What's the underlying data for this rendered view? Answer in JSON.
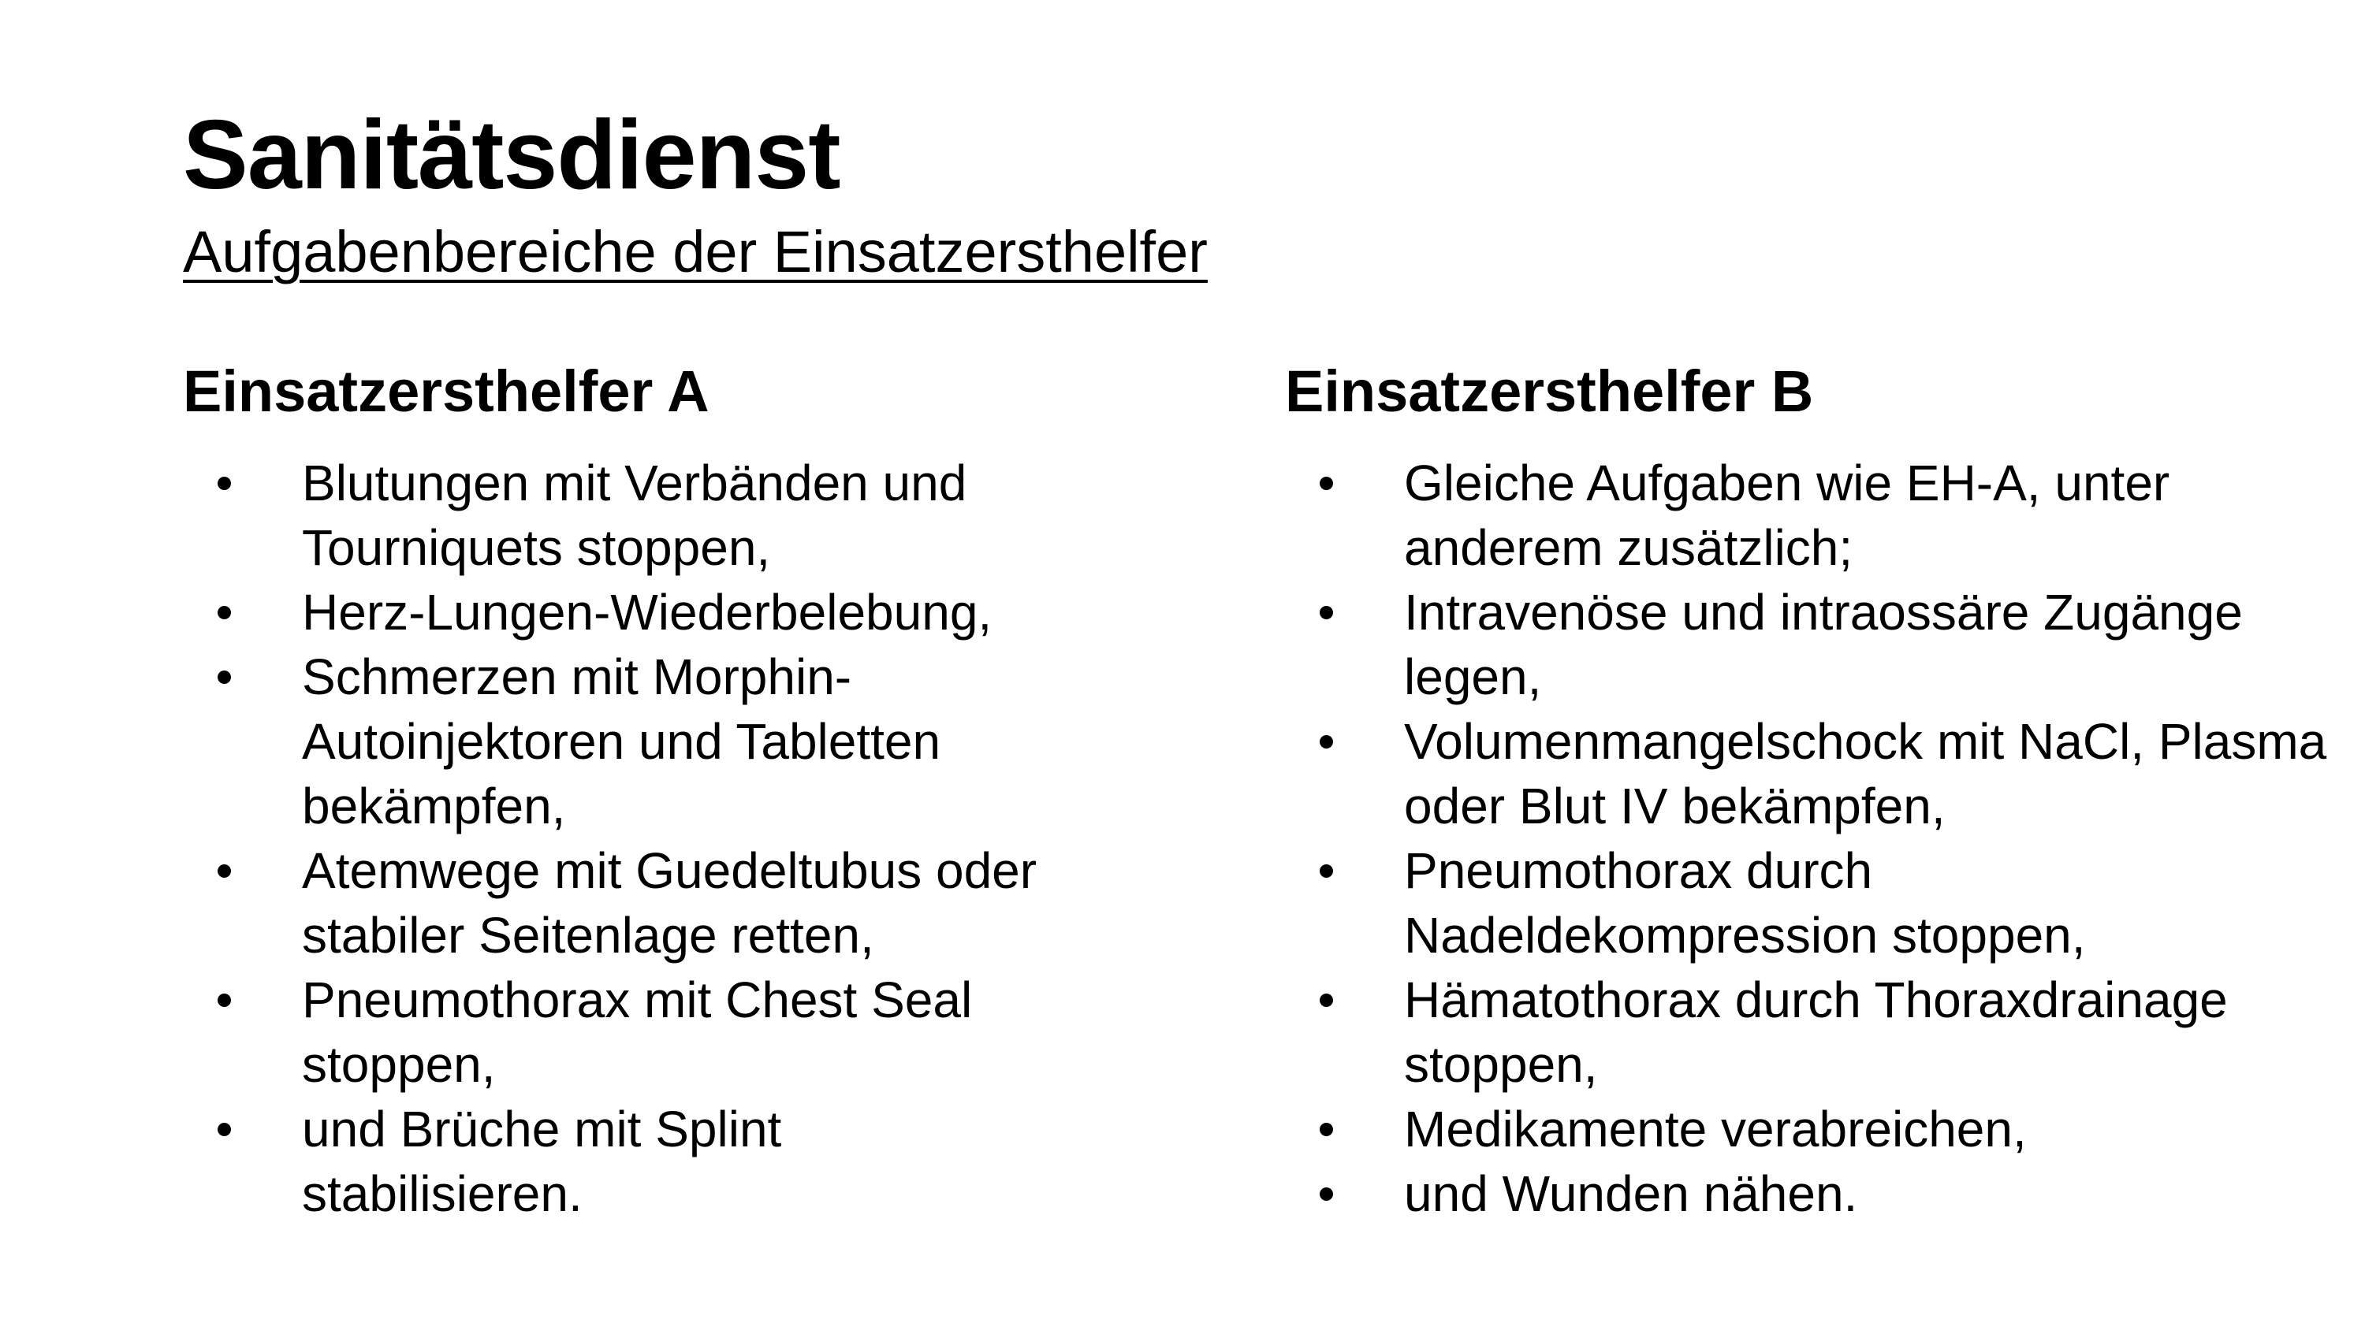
{
  "slide": {
    "title": "Sanitätsdienst",
    "subtitle": "Aufgabenbereiche der Einsatzersthelfer"
  },
  "columns": [
    {
      "heading": "Einsatzersthelfer A",
      "items": [
        "Blutungen mit Verbänden und Tourniquets stoppen,",
        "Herz-Lungen-Wiederbelebung,",
        "Schmerzen mit Morphin-Autoinjektoren und Tabletten bekämpfen,",
        "Atemwege mit Guedeltubus oder stabiler Seitenlage retten,",
        "Pneumothorax mit Chest Seal stoppen,",
        "und Brüche mit Splint stabilisieren."
      ]
    },
    {
      "heading": "Einsatzersthelfer B",
      "items": [
        "Gleiche Aufgaben wie EH-A, unter anderem zusätzlich;",
        "Intravenöse und intraossäre Zugänge legen,",
        "Volumenmangelschock mit NaCl, Plasma oder Blut IV bekämpfen,",
        "Pneumothorax durch Nadeldekompression stoppen,",
        "Hämatothorax durch Thoraxdrainage stoppen,",
        "Medikamente verabreichen,",
        "und Wunden nähen."
      ]
    }
  ]
}
